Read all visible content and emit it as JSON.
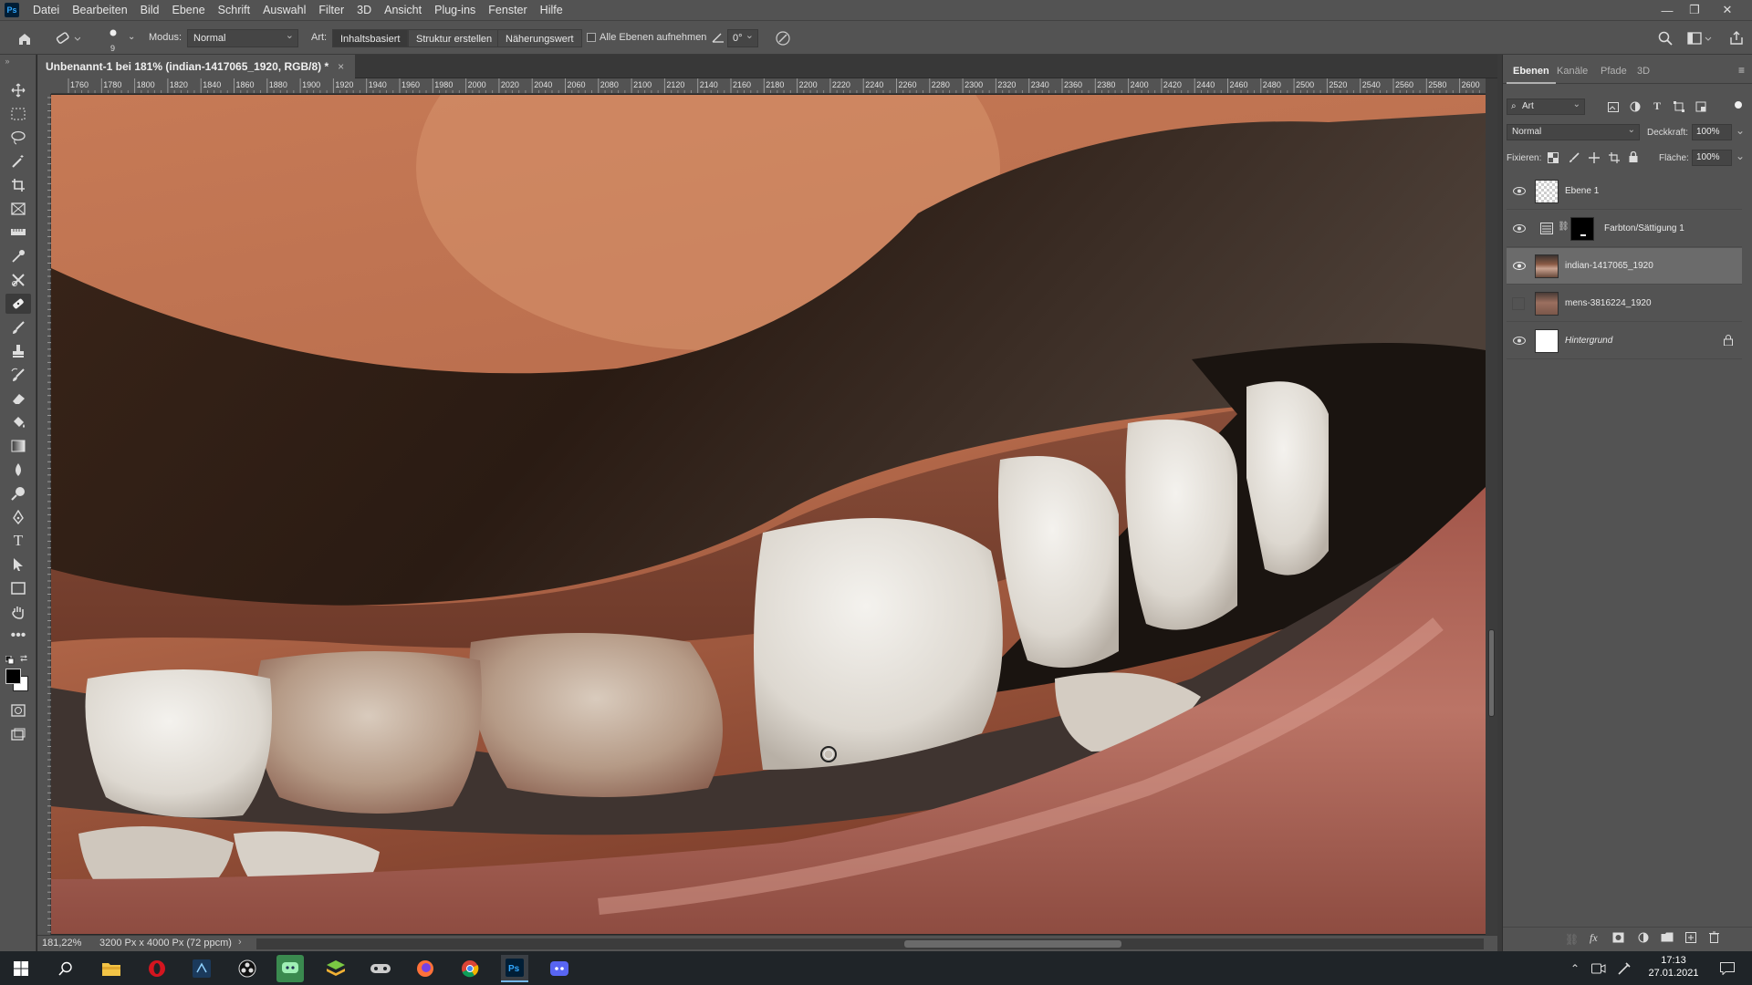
{
  "menubar": {
    "app_logo": "Ps",
    "items": [
      "Datei",
      "Bearbeiten",
      "Bild",
      "Ebene",
      "Schrift",
      "Auswahl",
      "Filter",
      "3D",
      "Ansicht",
      "Plug-ins",
      "Fenster",
      "Hilfe"
    ]
  },
  "options": {
    "brush_size": "9",
    "mode_label": "Modus:",
    "mode_value": "Normal",
    "type_label": "Art:",
    "type_content_aware": "Inhaltsbasiert",
    "type_create_texture": "Struktur erstellen",
    "type_proximity": "Näherungswert",
    "sample_all_layers": "Alle Ebenen aufnehmen",
    "angle_value": "0°"
  },
  "document": {
    "tab_title": "Unbenannt-1 bei 181% (indian-1417065_1920, RGB/8) *",
    "close": "×"
  },
  "ruler": {
    "ticks": [
      "1760",
      "1780",
      "1800",
      "1820",
      "1840",
      "1860",
      "1880",
      "1900",
      "1920",
      "1940",
      "1960",
      "1980",
      "2000",
      "2020",
      "2040",
      "2060",
      "2080",
      "2100",
      "2120",
      "2140",
      "2160",
      "2180",
      "2200",
      "2220",
      "2240",
      "2260",
      "2280",
      "2300",
      "2320",
      "2340",
      "2360",
      "2380",
      "2400",
      "2420",
      "2440",
      "2460",
      "2480",
      "2500",
      "2520",
      "2540",
      "2560",
      "2580",
      "2600"
    ]
  },
  "status": {
    "zoom": "181,22%",
    "doc_size": "3200 Px x 4000 Px (72 ppcm)"
  },
  "layers_panel": {
    "tabs": [
      "Ebenen",
      "Kanäle",
      "Pfade",
      "3D"
    ],
    "filter_type": "Art",
    "blend_mode": "Normal",
    "opacity_label": "Deckkraft:",
    "opacity_value": "100%",
    "lock_label": "Fixieren:",
    "fill_label": "Fläche:",
    "fill_value": "100%",
    "layers": [
      {
        "name": "Ebene 1",
        "visible": true,
        "selected": false,
        "kind": "transparent"
      },
      {
        "name": "Farbton/Sättigung 1",
        "visible": true,
        "selected": false,
        "kind": "adjustment"
      },
      {
        "name": "indian-1417065_1920",
        "visible": true,
        "selected": true,
        "kind": "photo"
      },
      {
        "name": "mens-3816224_1920",
        "visible": false,
        "selected": false,
        "kind": "photo2"
      },
      {
        "name": "Hintergrund",
        "visible": true,
        "selected": false,
        "kind": "background",
        "locked": true
      }
    ]
  },
  "taskbar": {
    "time": "17:13",
    "date": "27.01.2021"
  },
  "colors": {
    "ui_bg": "#535353",
    "panel_selected": "#6b6b6b",
    "taskbar": "#1f2428",
    "ps_blue": "#31a8ff"
  }
}
